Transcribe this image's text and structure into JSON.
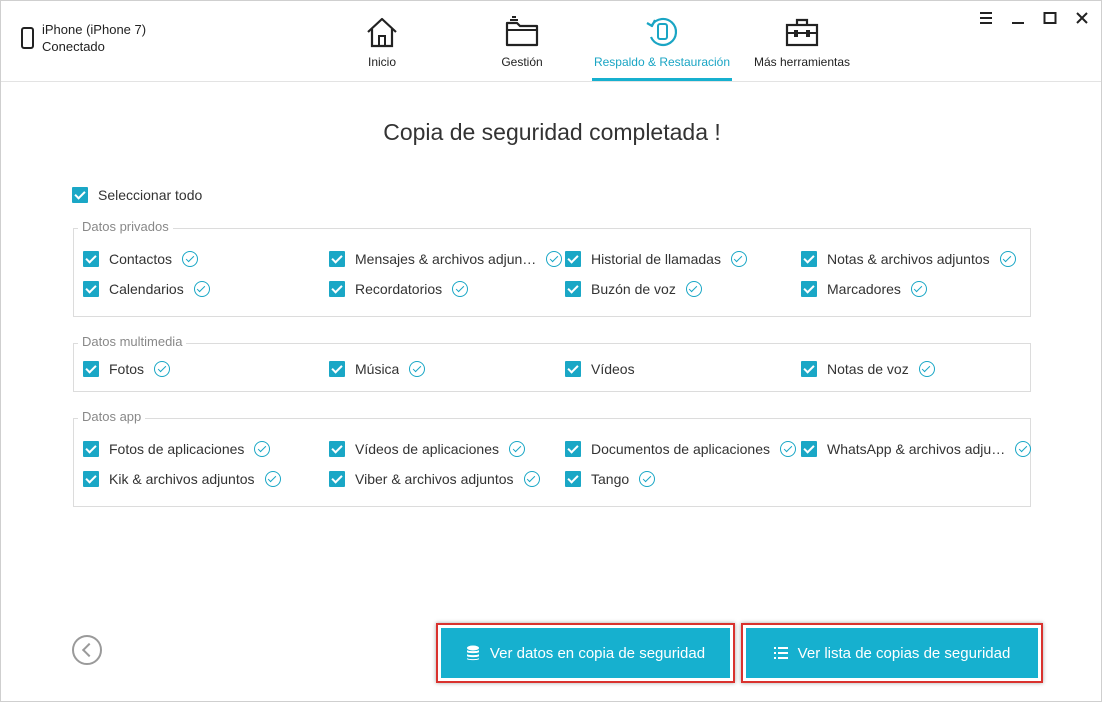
{
  "device": {
    "name": "iPhone (iPhone 7)",
    "status": "Conectado"
  },
  "nav": {
    "items": [
      {
        "label": "Inicio",
        "icon": "home-icon"
      },
      {
        "label": "Gestión",
        "icon": "folder-icon"
      },
      {
        "label": "Respaldo & Restauración",
        "icon": "backup-restore-icon",
        "active": true
      },
      {
        "label": "Más herramientas",
        "icon": "toolbox-icon"
      }
    ]
  },
  "window_controls": [
    "menu-icon",
    "minimize-icon",
    "maximize-icon",
    "close-icon"
  ],
  "main": {
    "title": "Copia de seguridad completada !",
    "select_all": "Seleccionar todo",
    "groups": [
      {
        "title": "Datos privados",
        "items": [
          {
            "label": "Contactos",
            "done": true
          },
          {
            "label": "Mensajes & archivos adjun…",
            "done": true
          },
          {
            "label": "Historial de llamadas",
            "done": true
          },
          {
            "label": "Notas & archivos adjuntos",
            "done": true
          },
          {
            "label": "Calendarios",
            "done": true
          },
          {
            "label": "Recordatorios",
            "done": true
          },
          {
            "label": "Buzón de voz",
            "done": true
          },
          {
            "label": "Marcadores",
            "done": true
          }
        ]
      },
      {
        "title": "Datos multimedia",
        "items": [
          {
            "label": "Fotos",
            "done": true
          },
          {
            "label": "Música",
            "done": true
          },
          {
            "label": "Vídeos",
            "done": false
          },
          {
            "label": "Notas de voz",
            "done": true
          }
        ]
      },
      {
        "title": "Datos app",
        "items": [
          {
            "label": "Fotos de aplicaciones",
            "done": true
          },
          {
            "label": "Vídeos de aplicaciones",
            "done": true
          },
          {
            "label": "Documentos de aplicaciones",
            "done": true
          },
          {
            "label": "WhatsApp & archivos adju…",
            "done": true
          },
          {
            "label": "Kik & archivos adjuntos",
            "done": true
          },
          {
            "label": "Viber & archivos adjuntos",
            "done": true
          },
          {
            "label": "Tango",
            "done": true
          }
        ]
      }
    ]
  },
  "footer": {
    "view_data_button": "Ver datos en copia de seguridad",
    "view_list_button": "Ver lista de copias de seguridad"
  },
  "colors": {
    "accent": "#16b0cf",
    "highlight_border": "#d9322e"
  }
}
